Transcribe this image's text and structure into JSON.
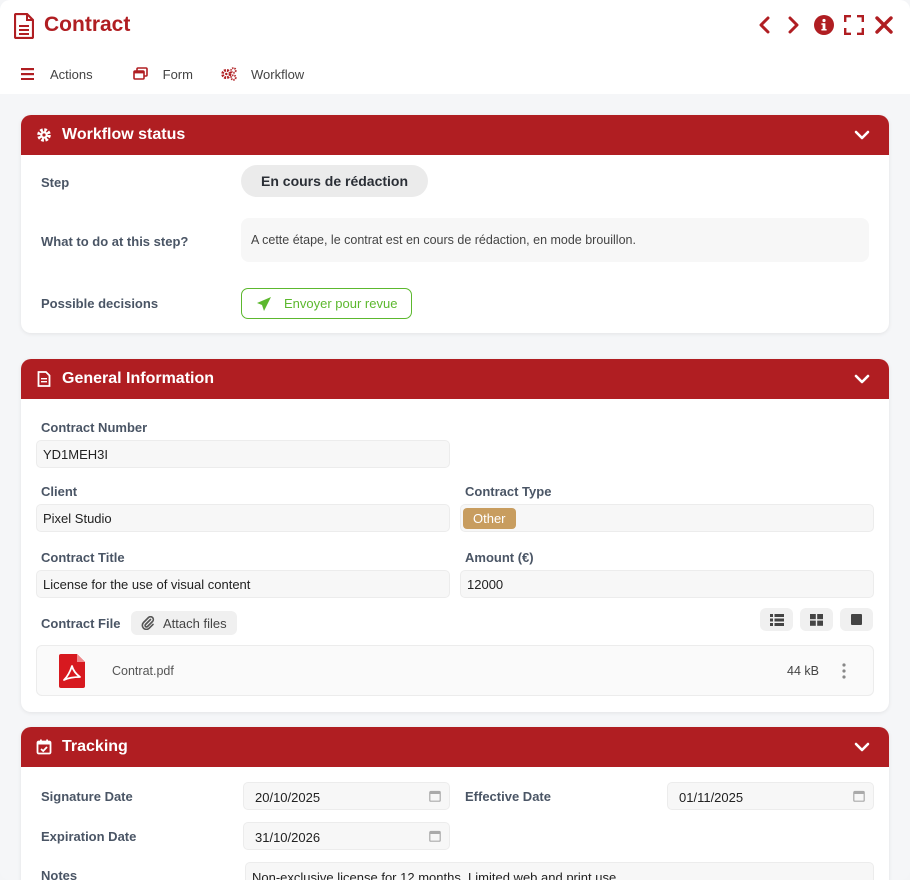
{
  "window": {
    "title": "Contract"
  },
  "toolbar": {
    "actions_label": "Actions",
    "form_label": "Form",
    "workflow_label": "Workflow"
  },
  "workflow_status": {
    "title": "Workflow status",
    "step_label": "Step",
    "step_value": "En cours de rédaction",
    "todo_label": "What to do at this step?",
    "todo_value": "A cette étape, le contrat est en cours de rédaction, en mode brouillon.",
    "decisions_label": "Possible decisions",
    "decision_button": "Envoyer pour revue"
  },
  "general": {
    "title": "General Information",
    "contract_number_label": "Contract Number",
    "contract_number_value": "YD1MEH3I",
    "client_label": "Client",
    "client_value": "Pixel Studio",
    "contract_type_label": "Contract Type",
    "contract_type_value": "Other",
    "contract_title_label": "Contract Title",
    "contract_title_value": "License for the use of visual content",
    "amount_label": "Amount (€)",
    "amount_value": "12000",
    "contract_file_label": "Contract File",
    "attach_label": "Attach files",
    "file": {
      "name": "Contrat.pdf",
      "size": "44 kB"
    }
  },
  "tracking": {
    "title": "Tracking",
    "signature_label": "Signature Date",
    "signature_value": "20/10/2025",
    "effective_label": "Effective Date",
    "effective_value": "01/11/2025",
    "expiration_label": "Expiration Date",
    "expiration_value": "31/10/2026",
    "notes_label": "Notes",
    "notes_value": "Non-exclusive license for 12 months. Limited web and print use."
  },
  "colors": {
    "brand": "#b01e22",
    "success": "#5cb82e",
    "tag": "#c89d5f"
  }
}
